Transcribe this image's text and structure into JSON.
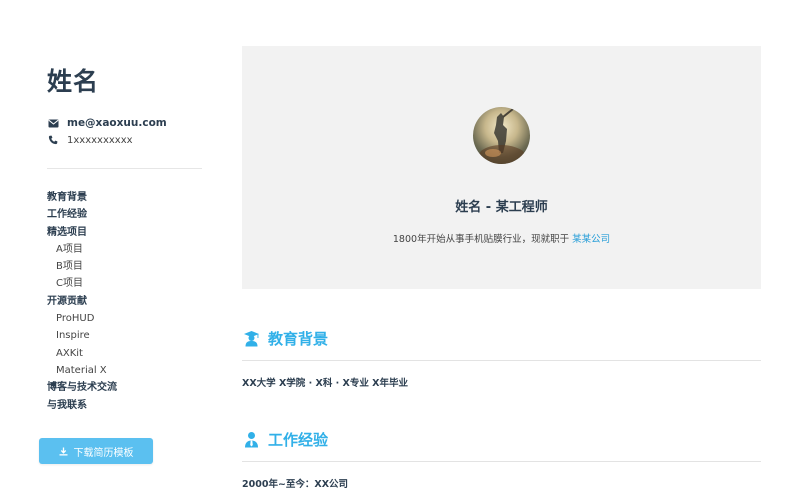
{
  "sidebar": {
    "name": "姓名",
    "email": "me@xaoxuu.com",
    "phone": "1xxxxxxxxxx",
    "nav": [
      {
        "label": "教育背景",
        "sub": false
      },
      {
        "label": "工作经验",
        "sub": false
      },
      {
        "label": "精选项目",
        "sub": false
      },
      {
        "label": "A项目",
        "sub": true
      },
      {
        "label": "B项目",
        "sub": true
      },
      {
        "label": "C项目",
        "sub": true
      },
      {
        "label": "开源贡献",
        "sub": false
      },
      {
        "label": "ProHUD",
        "sub": true
      },
      {
        "label": "Inspire",
        "sub": true
      },
      {
        "label": "AXKit",
        "sub": true
      },
      {
        "label": "Material X",
        "sub": true
      },
      {
        "label": "博客与技术交流",
        "sub": false
      },
      {
        "label": "与我联系",
        "sub": false
      }
    ],
    "download_label": "下载简历模板"
  },
  "hero": {
    "title": "姓名 - 某工程师",
    "desc_prefix": "1800年开始从事手机贴膜行业，现就职于 ",
    "desc_link": "某某公司"
  },
  "sections": [
    {
      "id": "education",
      "title": "教育背景",
      "icon": "graduate-icon",
      "text": "XX大学 X学院 · X科 · X专业 X年毕业"
    },
    {
      "id": "work",
      "title": "工作经验",
      "icon": "user-tie-icon",
      "text": "2000年~至今：XX公司"
    }
  ],
  "colors": {
    "accent": "#31b0e8",
    "button": "#5bc0f0",
    "text": "#2c3e50",
    "hero_bg": "#f2f2f2",
    "link": "#2a9fd8"
  }
}
